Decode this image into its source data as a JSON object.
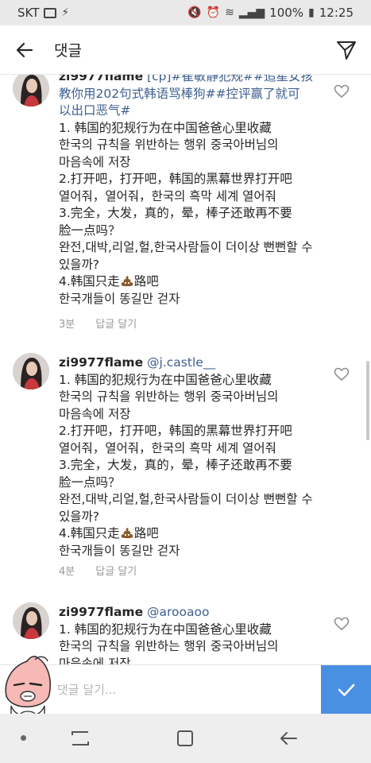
{
  "status_bar": {
    "carrier": "SKT",
    "battery": "100%",
    "time": "12:25"
  },
  "header": {
    "title": "댓글",
    "back_icon": "arrow-left-icon",
    "share_icon": "paper-plane-icon"
  },
  "comments": [
    {
      "username": "zi9977flame",
      "head_rest": " [cp]#崔敏静犯规##追星女孩",
      "lines": [
        "教你用202句式韩语骂棒狗##控评赢了就可",
        "以出口恶气#",
        "1. 韩国的犯规行为在中国爸爸心里收藏",
        "한국의 규칙을 위반하는 행위 중국아버님의",
        "마음속에 저장",
        "2.打开吧，打开吧，韩国的黑幕世界打开吧",
        "열어줘，열어줘，한국의 흑막 세계 열어줘",
        "3.完全，大发，真的，晕，棒子还敢再不要",
        "脸一点吗？",
        "완전,대박,리얼,헐,한국사람들이 더이상 뻔뻔할 수",
        "있을까?"
      ],
      "line4_a": "4.韩国只走",
      "line4_b": "路吧",
      "last_line": "한국개들이 똥길만 걷자",
      "time": "3분",
      "reply": "답글 달기"
    },
    {
      "username": "zi9977flame",
      "mention": "@j.castle__",
      "lines": [
        "1. 韩国的犯规行为在中国爸爸心里收藏",
        "한국의 규칙을 위반하는 행위 중국아버님의",
        "마음속에 저장",
        "2.打开吧，打开吧，韩国的黑幕世界打开吧",
        "열어줘，열어줘，한국의 흑막 세계 열어줘",
        "3.完全，大发，真的，晕，棒子还敢再不要",
        "脸一点吗？",
        "완전,대박,리얼,헐,한국사람들이 더이상 뻔뻔할 수",
        "있을까?"
      ],
      "line4_a": "4.韩国只走",
      "line4_b": "路吧",
      "last_line": "한국개들이 똥길만 걷자",
      "time": "4분",
      "reply": "답글 달기"
    },
    {
      "username": "zi9977flame",
      "mention": "@arooaoo",
      "lines": [
        "1. 韩国的犯规行为在中国爸爸心里收藏",
        "한국의 규칙을 위반하는 행위 중국아버님의",
        "마음속에 저장"
      ]
    }
  ],
  "compose": {
    "placeholder": "댓글 달기...",
    "post_icon": "checkmark-icon"
  },
  "colors": {
    "accent": "#4a90e2",
    "mention": "#3d5f8f",
    "meta": "#999999"
  }
}
